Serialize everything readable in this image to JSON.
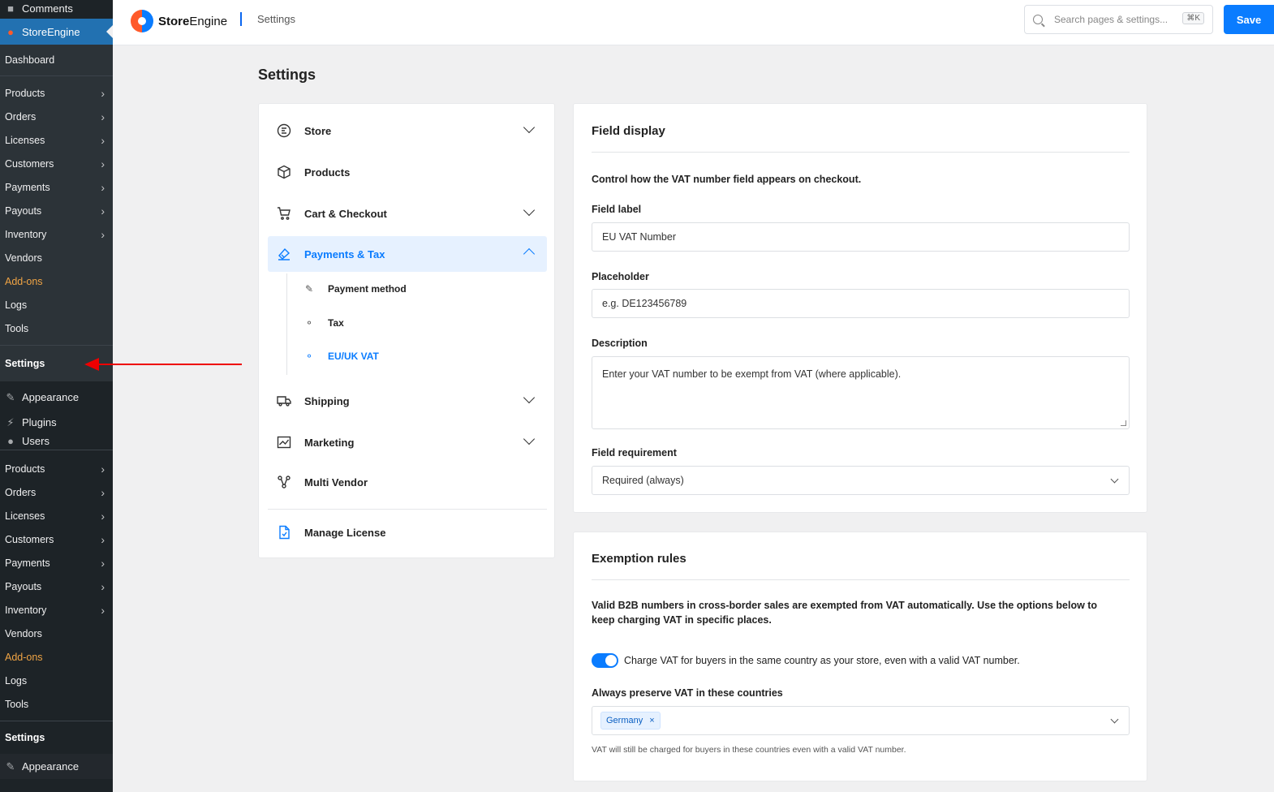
{
  "wp_sidebar": {
    "comments": "Comments",
    "storeengine": "StoreEngine",
    "dashboard": "Dashboard",
    "menu1": [
      {
        "label": "Products",
        "chevron": true
      },
      {
        "label": "Orders",
        "chevron": true
      },
      {
        "label": "Licenses",
        "chevron": true
      },
      {
        "label": "Customers",
        "chevron": true
      },
      {
        "label": "Payments",
        "chevron": true
      },
      {
        "label": "Payouts",
        "chevron": true
      },
      {
        "label": "Inventory",
        "chevron": true
      },
      {
        "label": "Vendors",
        "chevron": false
      },
      {
        "label": "Add-ons",
        "chevron": false
      },
      {
        "label": "Logs",
        "chevron": false
      },
      {
        "label": "Tools",
        "chevron": false
      }
    ],
    "settings": "Settings",
    "appearance": "Appearance",
    "plugins": "Plugins",
    "users": "Users",
    "menu2": [
      {
        "label": "Products",
        "chevron": true
      },
      {
        "label": "Orders",
        "chevron": true
      },
      {
        "label": "Licenses",
        "chevron": true
      },
      {
        "label": "Customers",
        "chevron": true
      },
      {
        "label": "Payments",
        "chevron": true
      },
      {
        "label": "Payouts",
        "chevron": true
      },
      {
        "label": "Inventory",
        "chevron": true
      },
      {
        "label": "Vendors",
        "chevron": false
      },
      {
        "label": "Add-ons",
        "chevron": false
      },
      {
        "label": "Logs",
        "chevron": false
      },
      {
        "label": "Tools",
        "chevron": false
      }
    ],
    "settings2": "Settings",
    "appearance2": "Appearance"
  },
  "header": {
    "brand_bold": "Store",
    "brand_light": "Engine",
    "breadcrumb": "Settings",
    "search_placeholder": "Search pages & settings...",
    "search_shortcut": "⌘K",
    "save_label": "Save"
  },
  "page_title": "Settings",
  "settings_nav": {
    "store": "Store",
    "products": "Products",
    "cart_checkout": "Cart & Checkout",
    "payments_tax": "Payments & Tax",
    "sub": {
      "payment_method": "Payment method",
      "tax": "Tax",
      "eu_uk_vat": "EU/UK VAT"
    },
    "shipping": "Shipping",
    "marketing": "Marketing",
    "multi_vendor": "Multi Vendor",
    "manage_license": "Manage License"
  },
  "field_display": {
    "title": "Field display",
    "description": "Control how the VAT number field appears on checkout.",
    "field_label_label": "Field label",
    "field_label_value": "EU VAT Number",
    "placeholder_label": "Placeholder",
    "placeholder_value": "e.g. DE123456789",
    "description_label": "Description",
    "description_value": "Enter your VAT number to be exempt from VAT (where applicable).",
    "requirement_label": "Field requirement",
    "requirement_value": "Required (always)"
  },
  "exemption_rules": {
    "title": "Exemption rules",
    "description": "Valid B2B numbers in cross-border sales are exempted from VAT automatically. Use the options below to keep charging VAT in specific places.",
    "toggle_on": true,
    "toggle_label": "Charge VAT for buyers in the same country as your store, even with a valid VAT number.",
    "countries_label": "Always preserve VAT in these countries",
    "countries": [
      "Germany"
    ],
    "chip_remove": "×",
    "help_text": "VAT will still be charged for buyers in these countries even with a valid VAT number."
  },
  "colors": {
    "accent": "#0a7cff",
    "wp_sidebar": "#1d2327",
    "addons_orange": "#f0a444",
    "annotation_arrow": "#e00000"
  }
}
